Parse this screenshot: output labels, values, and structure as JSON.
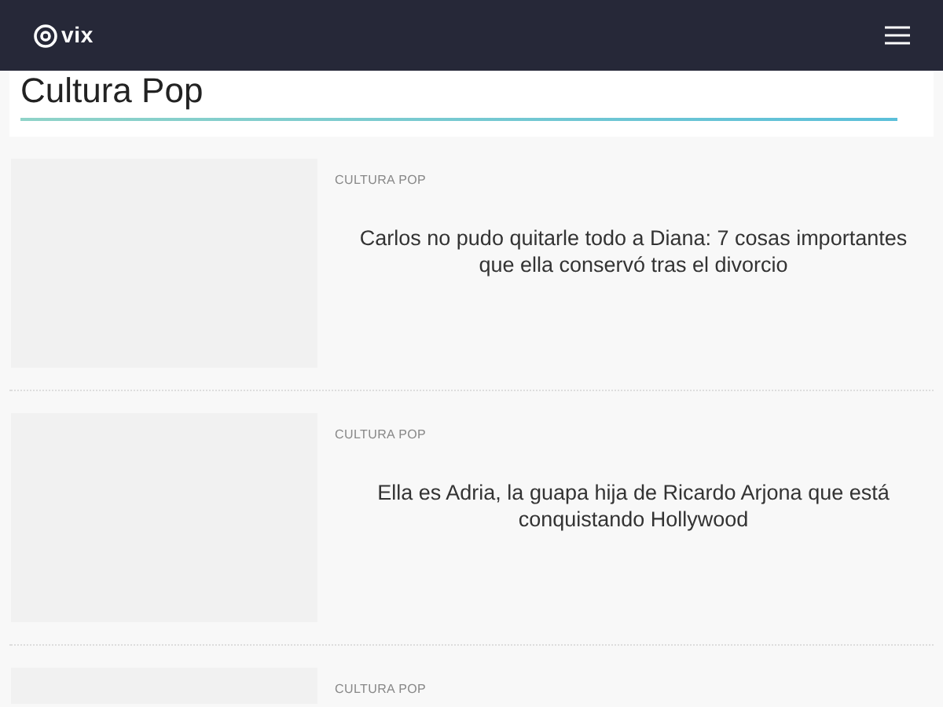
{
  "header": {
    "logo": "vix"
  },
  "section": {
    "title": "Cultura Pop"
  },
  "articles": [
    {
      "category": "CULTURA POP",
      "headline": "Carlos no pudo quitarle todo a Diana: 7 cosas importantes que ella conservó tras el divorcio"
    },
    {
      "category": "CULTURA POP",
      "headline": "Ella es Adria, la guapa hija de Ricardo Arjona que está conquistando Hollywood"
    },
    {
      "category": "CULTURA POP"
    }
  ]
}
